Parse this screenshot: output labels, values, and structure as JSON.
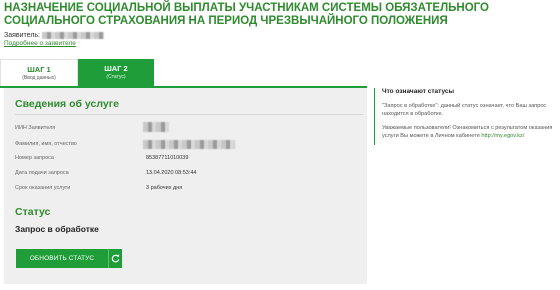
{
  "page": {
    "title": "НАЗНАЧЕНИЕ СОЦИАЛЬНОЙ ВЫПЛАТЫ УЧАСТНИКАМ СИСТЕМЫ ОБЯЗАТЕЛЬНОГО СОЦИАЛЬНОГО СТРАХОВАНИЯ НА ПЕРИОД ЧРЕЗВЫЧАЙНОГО ПОЛОЖЕНИЯ"
  },
  "applicant": {
    "label": "Заявитель:",
    "details_link": "Подробнее о заявителе"
  },
  "steps": [
    {
      "title": "ШАГ 1",
      "subtitle": "(Ввод данных)",
      "active": false
    },
    {
      "title": "ШАГ 2",
      "subtitle": "(Статус)",
      "active": true
    }
  ],
  "service_info": {
    "title": "Сведения об услуге",
    "rows": [
      {
        "label": "ИИН Заявителя",
        "value": ""
      },
      {
        "label": "Фамилия, имя, отчество",
        "value": ""
      },
      {
        "label": "Номер запроса",
        "value": "85387711010039"
      },
      {
        "label": "Дата подачи запроса",
        "value": "13.04.2020 08:53:44"
      },
      {
        "label": "Срок оказания услуги",
        "value": "3 рабочих дня"
      }
    ]
  },
  "status": {
    "title": "Статус",
    "value": "Запрос в обработке",
    "refresh_button": "ОБНОВИТЬ СТАТУС"
  },
  "aside": {
    "title": "Что означают статусы",
    "p1": "\"Запрос в обработке\": данный статус означает, что Ваш запрос находится в обработке.",
    "p2_text": "Уважаемые пользователи! Ознакомиться с результатом оказания услуги Вы можете в Личном кабинете ",
    "p2_link": "http://my.egov.kz/"
  },
  "colors": {
    "accent": "#1e9d39",
    "title_green": "#2e8b2e",
    "panel_bg": "#efefef"
  },
  "icons": {
    "refresh": "refresh-icon"
  }
}
